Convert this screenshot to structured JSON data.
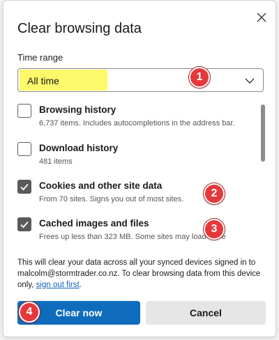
{
  "dialog": {
    "title": "Clear browsing data",
    "close_icon": "close-icon"
  },
  "time_range": {
    "label": "Time range",
    "value": "All time",
    "icon": "chevron-down-icon",
    "highlight_color": "#fdf96a"
  },
  "items": [
    {
      "title": "Browsing history",
      "subtitle": "6,737 items. Includes autocompletions in the address bar.",
      "checked": false
    },
    {
      "title": "Download history",
      "subtitle": "481 items",
      "checked": false
    },
    {
      "title": "Cookies and other site data",
      "subtitle": "From 70 sites. Signs you out of most sites.",
      "checked": true
    },
    {
      "title": "Cached images and files",
      "subtitle": "Frees up less than 323 MB. Some sites may load more",
      "checked": true
    }
  ],
  "info": {
    "text": "This will clear your data across all your synced devices signed in to malcolm@stormtrader.co.nz. To clear browsing data from this device only,",
    "link": "sign out first",
    "suffix": "."
  },
  "buttons": {
    "primary": "Clear now",
    "secondary": "Cancel"
  },
  "annotations": [
    "1",
    "2",
    "3",
    "4"
  ],
  "colors": {
    "primary": "#0f6cbd",
    "badge": "#e5383b",
    "link": "#0f5fb8"
  }
}
